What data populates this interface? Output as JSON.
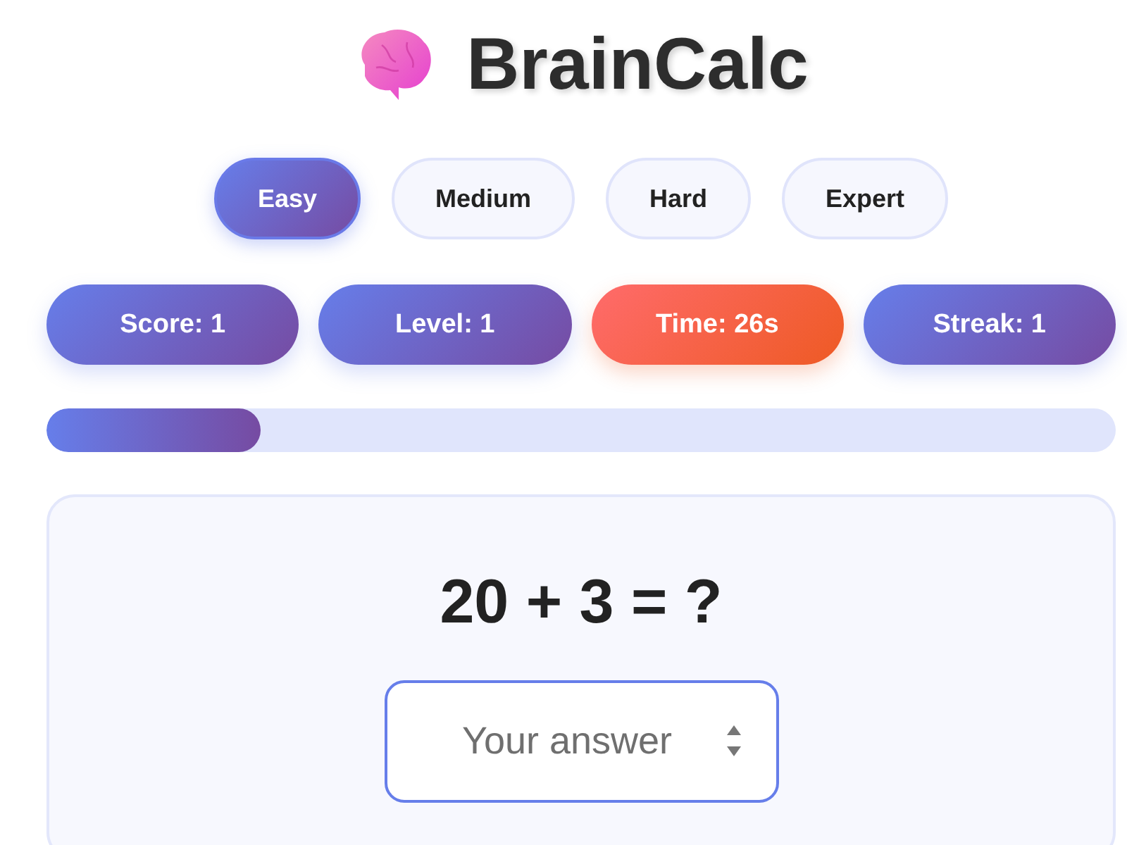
{
  "app": {
    "title": "BrainCalc"
  },
  "difficulties": [
    {
      "label": "Easy",
      "selected": true
    },
    {
      "label": "Medium",
      "selected": false
    },
    {
      "label": "Hard",
      "selected": false
    },
    {
      "label": "Expert",
      "selected": false
    }
  ],
  "stats": [
    {
      "label": "Score: 1",
      "kind": "stat"
    },
    {
      "label": "Level: 1",
      "kind": "stat"
    },
    {
      "label": "Time: 26s",
      "kind": "timer"
    },
    {
      "label": "Streak: 1",
      "kind": "stat"
    }
  ],
  "progress": {
    "level": 0.2
  },
  "question": {
    "text": "20 + 3 = ?"
  },
  "answer": {
    "placeholder": "Your answer"
  }
}
